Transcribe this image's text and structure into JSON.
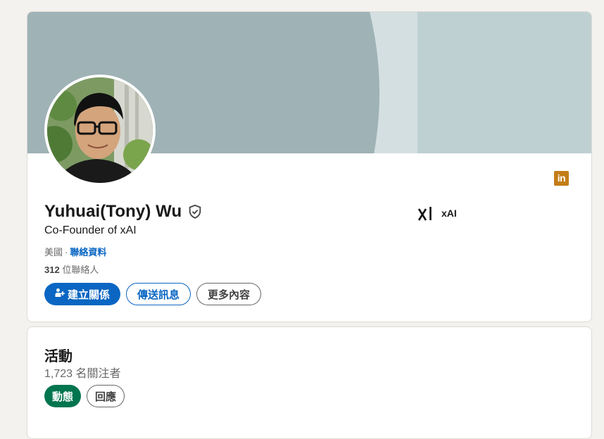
{
  "profile": {
    "name": "Yuhuai(Tony) Wu",
    "headline": "Co-Founder of xAI",
    "location": "美國",
    "separator": "·",
    "contact_link": "聯絡資料",
    "connections_count": "312",
    "connections_label": "位聯絡人",
    "verified_icon": "shield-check-icon",
    "linkedin_logo_text": "in"
  },
  "company": {
    "logo_text": "xAI",
    "name": "xAI"
  },
  "actions": {
    "connect_label": "建立關係",
    "message_label": "傳送訊息",
    "more_label": "更多內容"
  },
  "activity": {
    "title": "活動",
    "followers": "1,723 名關注者",
    "tabs": [
      "動態",
      "回應"
    ],
    "active_tab": "動態"
  },
  "colors": {
    "primary": "#0a66c2",
    "active_pill": "#01754f",
    "linkedin_badge": "#c37d16",
    "banner": "#bfd0d3",
    "banner_circle": "#9fb2b6"
  }
}
